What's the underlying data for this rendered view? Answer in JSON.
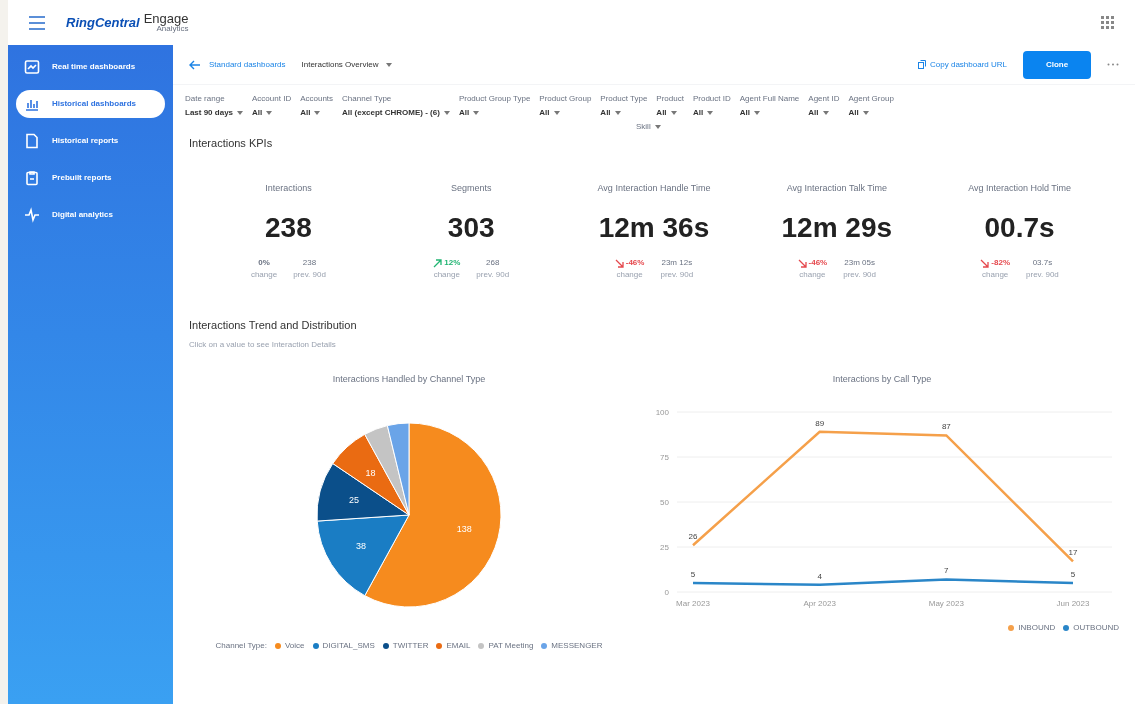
{
  "header": {
    "brand_primary": "RingCentral",
    "brand_secondary": "Engage",
    "brand_sub": "Analytics"
  },
  "sidebar": {
    "items": [
      {
        "label": "Real time dashboards",
        "selected": false,
        "kind": "monitor"
      },
      {
        "label": "Historical dashboards",
        "selected": true,
        "kind": "chart"
      },
      {
        "label": "Historical reports",
        "selected": false,
        "kind": "file"
      },
      {
        "label": "Prebuilt reports",
        "selected": false,
        "kind": "clipboard"
      },
      {
        "label": "Digital analytics",
        "selected": false,
        "kind": "pulse"
      }
    ]
  },
  "toolbar": {
    "breadcrumb": "Standard dashboards",
    "dashboard": "Interactions Overview",
    "copy_link": "Copy dashboard URL",
    "clone": "Clone"
  },
  "filters": [
    {
      "label": "Date range",
      "value": "Last 90 days"
    },
    {
      "label": "Account ID",
      "value": "All"
    },
    {
      "label": "Accounts",
      "value": "All"
    },
    {
      "label": "Channel Type",
      "value": "All (except CHROME) - (6)"
    },
    {
      "label": "Product Group Type",
      "value": "All"
    },
    {
      "label": "Product Group",
      "value": "All"
    },
    {
      "label": "Product Type",
      "value": "All"
    },
    {
      "label": "Product",
      "value": "All"
    },
    {
      "label": "Product ID",
      "value": "All"
    },
    {
      "label": "Agent Full Name",
      "value": "All"
    },
    {
      "label": "Agent ID",
      "value": "All"
    },
    {
      "label": "Agent Group",
      "value": "All"
    }
  ],
  "extra_filter": "Skill",
  "kpi_section": {
    "title": "Interactions KPIs",
    "kpis": [
      {
        "label": "Interactions",
        "value": "238",
        "change": "0%",
        "kind": "flat",
        "change_caption": "change",
        "previous": "238",
        "previous_caption": "prev. 90d"
      },
      {
        "label": "Segments",
        "value": "303",
        "change": "12%",
        "kind": "up",
        "change_caption": "change",
        "previous": "268",
        "previous_caption": "prev. 90d"
      },
      {
        "label": "Avg Interaction Handle Time",
        "value": "12m 36s",
        "change": "-46%",
        "kind": "down",
        "change_caption": "change",
        "previous": "23m 12s",
        "previous_caption": "prev. 90d"
      },
      {
        "label": "Avg Interaction Talk Time",
        "value": "12m 29s",
        "change": "-46%",
        "kind": "down",
        "change_caption": "change",
        "previous": "23m 05s",
        "previous_caption": "prev. 90d"
      },
      {
        "label": "Avg Interaction Hold Time",
        "value": "00.7s",
        "change": "-82%",
        "kind": "down",
        "change_caption": "change",
        "previous": "03.7s",
        "previous_caption": "prev. 90d"
      }
    ]
  },
  "trend_section": {
    "title": "Interactions Trend and Distribution",
    "subtitle": "Click on a value to see Interaction Details",
    "pie": {
      "legend_title": "Channel Type:",
      "chart_data": {
        "type": "pie",
        "title": "Interactions Handled by Channel Type",
        "categories": [
          "Voice",
          "DIGITAL_SMS",
          "TWITTER",
          "EMAIL",
          "PAT Meeting",
          "MESSENGER"
        ],
        "values": [
          138,
          38,
          25,
          18,
          10,
          9
        ],
        "colors": [
          "#f68b1e",
          "#1a7dc4",
          "#0b4f8a",
          "#ea6b12",
          "#c4c4c4",
          "#6aa4e8"
        ],
        "value_labels": [
          "138",
          "38",
          "25",
          "18",
          null,
          null
        ]
      }
    },
    "line": {
      "chart_data": {
        "type": "line",
        "title": "Interactions by Call Type",
        "categories": [
          "Mar 2023",
          "Apr 2023",
          "May 2023",
          "Jun 2023"
        ],
        "yticks": [
          0,
          25,
          50,
          75,
          100
        ],
        "ylim": [
          0,
          100
        ],
        "grid": true,
        "series": [
          {
            "name": "INBOUND",
            "color": "#f5a04a",
            "values": [
              26,
              89,
              87,
              17
            ]
          },
          {
            "name": "OUTBOUND",
            "color": "#2a86c8",
            "values": [
              5,
              4,
              7,
              5
            ]
          }
        ],
        "data_labels": true
      }
    }
  }
}
